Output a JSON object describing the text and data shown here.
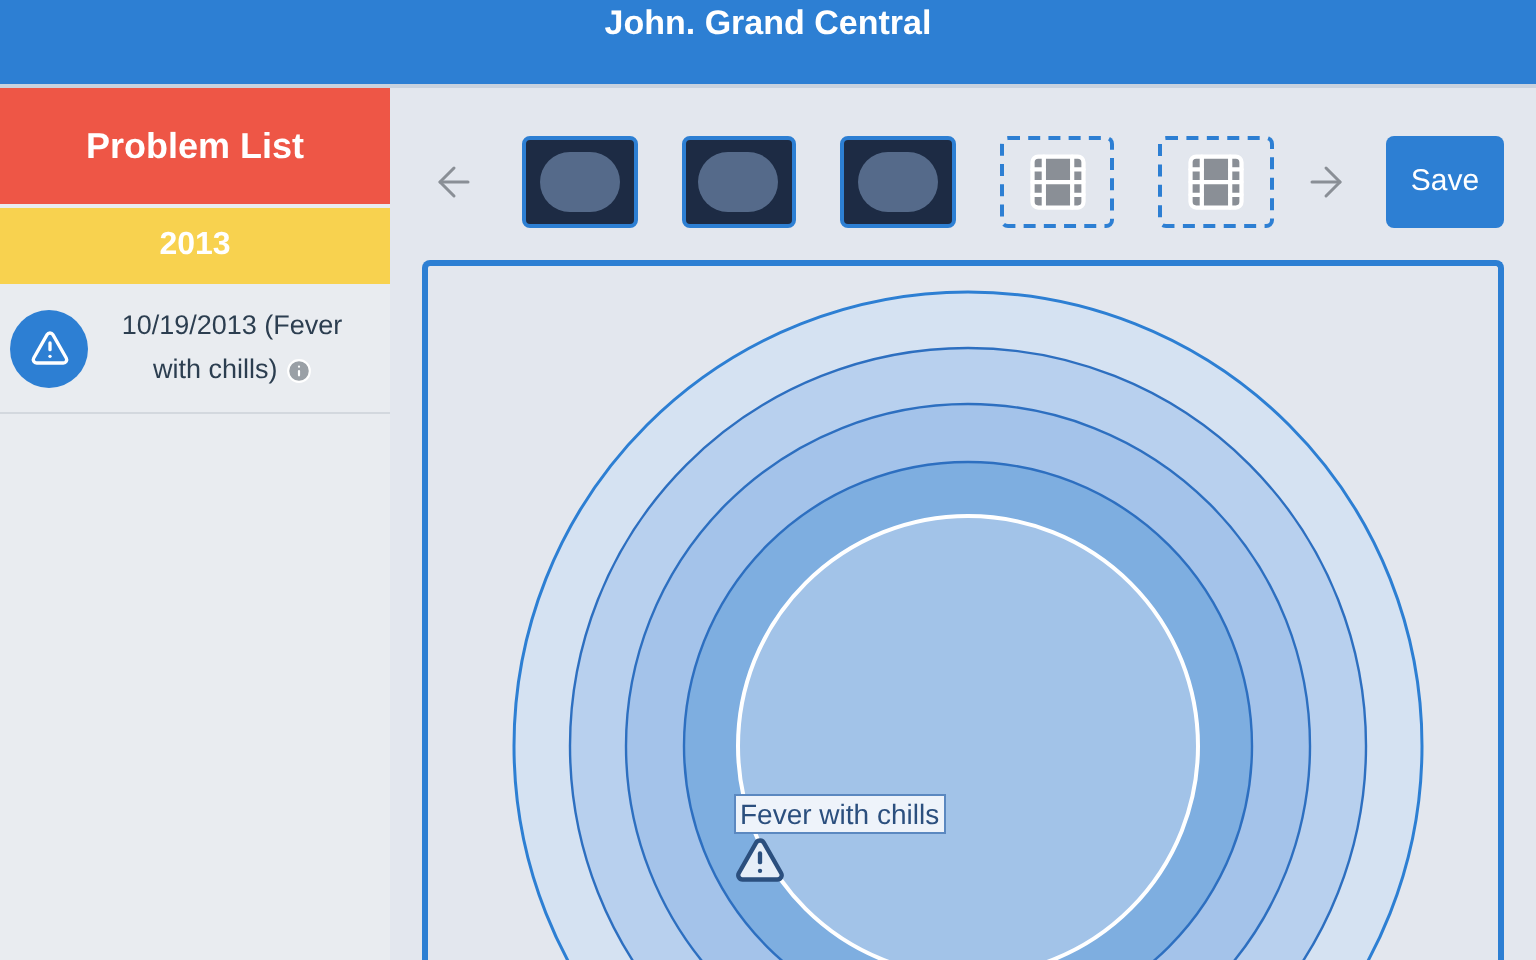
{
  "header": {
    "title": "John. Grand Central"
  },
  "sidebar": {
    "title": "Problem List",
    "year": "2013",
    "items": [
      {
        "text": "10/19/2013 (Fever with chills)"
      }
    ]
  },
  "toolbar": {
    "thumbnails": [
      {
        "kind": "image"
      },
      {
        "kind": "image"
      },
      {
        "kind": "image"
      },
      {
        "kind": "empty"
      },
      {
        "kind": "empty"
      }
    ],
    "save": "Save"
  },
  "canvas": {
    "markers": [
      {
        "label": "Fever with chills"
      }
    ]
  }
}
